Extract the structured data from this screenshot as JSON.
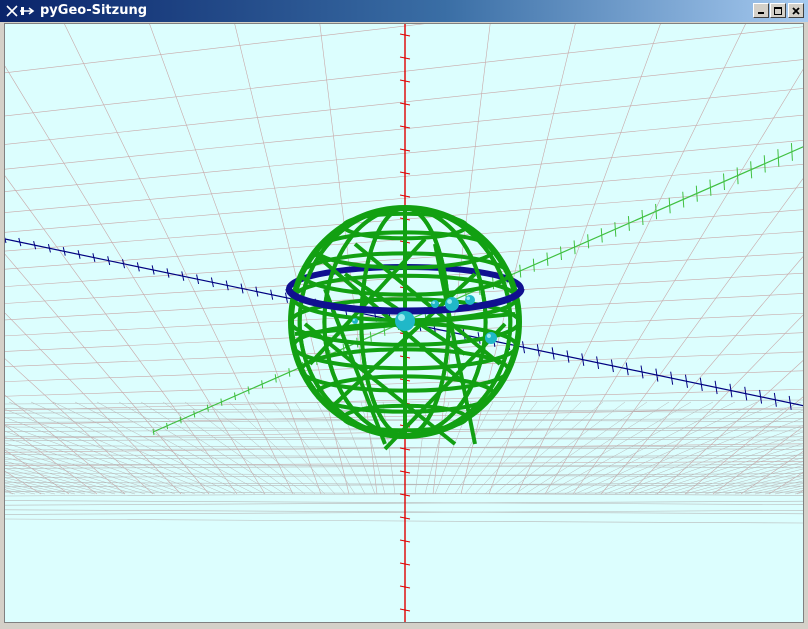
{
  "window": {
    "title": "pyGeo-Sitzung",
    "buttons": [
      "minimize",
      "maximize",
      "close"
    ]
  },
  "scene": {
    "background": "#dcfefe",
    "grid_color": "#c8a8a8",
    "floor_grid_color": "#b8b8b8",
    "axes": [
      {
        "name": "vertical-axis",
        "color": "#e00000"
      },
      {
        "name": "depth-axis",
        "color": "#000080"
      },
      {
        "name": "horizontal-axis",
        "color": "#40c040"
      }
    ],
    "objects": [
      {
        "name": "wireframe-sphere",
        "color": "#12a012"
      },
      {
        "name": "equator-ring",
        "color": "#101090"
      },
      {
        "name": "points",
        "color": "#20b8c8"
      }
    ]
  }
}
